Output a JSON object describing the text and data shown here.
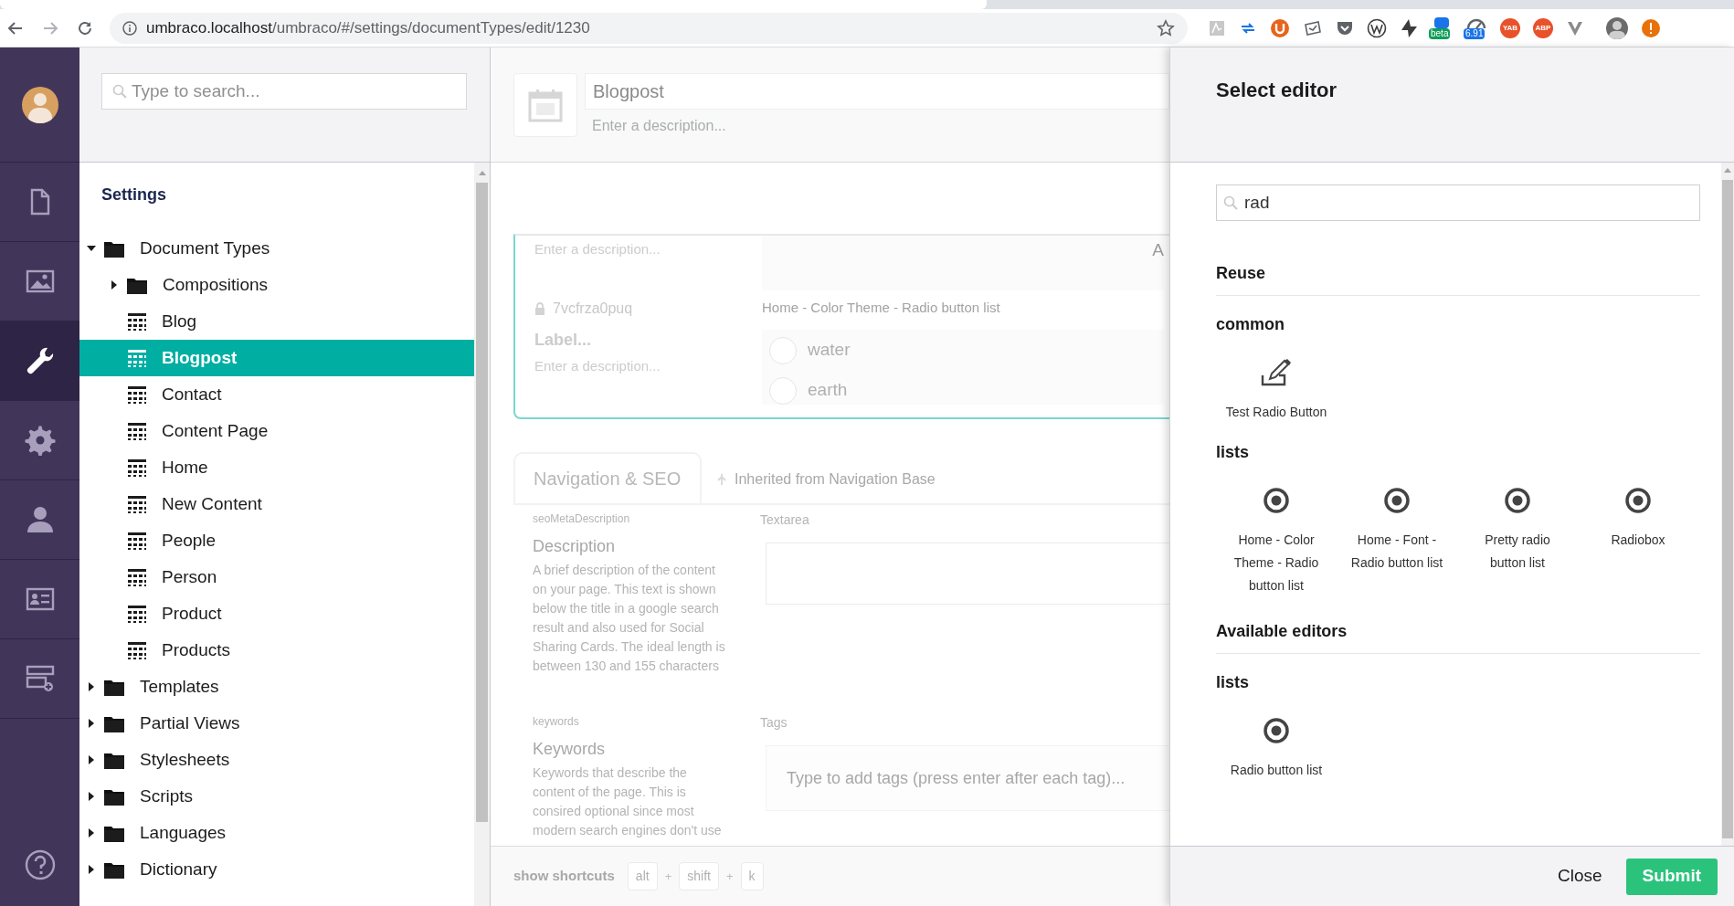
{
  "browser": {
    "url_host": "umbraco.localhost",
    "url_path": "/umbraco/#/settings/documentTypes/edit/1230",
    "extensions": [
      {
        "kind": "pdf"
      },
      {
        "kind": "arrows"
      },
      {
        "kind": "shield"
      },
      {
        "kind": "scan"
      },
      {
        "kind": "pocket"
      },
      {
        "kind": "wp"
      },
      {
        "kind": "bolt"
      },
      {
        "kind": "tag",
        "badge": "beta"
      },
      {
        "kind": "gauge",
        "badge": "6.91"
      },
      {
        "kind": "round",
        "text": "YAB"
      },
      {
        "kind": "round",
        "text": "ABP"
      },
      {
        "kind": "vee"
      },
      {
        "kind": "avatar"
      },
      {
        "kind": "alert"
      }
    ]
  },
  "sections": [
    {
      "selected": false
    },
    {
      "selected": false
    },
    {
      "selected": true
    },
    {
      "selected": false
    },
    {
      "selected": false
    },
    {
      "selected": false
    },
    {
      "selected": false
    }
  ],
  "tree": {
    "search_placeholder": "Type to search...",
    "title": "Settings",
    "nodes": [
      {
        "label": "Document Types",
        "kind": "folder",
        "expanded": true,
        "selected": false,
        "children": [
          {
            "label": "Compositions",
            "kind": "folder",
            "expanded": false,
            "selected": false
          },
          {
            "label": "Blog",
            "kind": "doctype",
            "selected": false
          },
          {
            "label": "Blogpost",
            "kind": "doctype",
            "selected": true
          },
          {
            "label": "Contact",
            "kind": "doctype",
            "selected": false
          },
          {
            "label": "Content Page",
            "kind": "doctype",
            "selected": false
          },
          {
            "label": "Home",
            "kind": "doctype",
            "selected": false
          },
          {
            "label": "New Content",
            "kind": "doctype",
            "selected": false
          },
          {
            "label": "People",
            "kind": "doctype",
            "selected": false
          },
          {
            "label": "Person",
            "kind": "doctype",
            "selected": false
          },
          {
            "label": "Product",
            "kind": "doctype",
            "selected": false
          },
          {
            "label": "Products",
            "kind": "doctype",
            "selected": false
          }
        ]
      },
      {
        "label": "Templates",
        "kind": "folder",
        "expanded": false,
        "selected": false
      },
      {
        "label": "Partial Views",
        "kind": "folder",
        "expanded": false,
        "selected": false
      },
      {
        "label": "Stylesheets",
        "kind": "folder",
        "expanded": false,
        "selected": false
      },
      {
        "label": "Scripts",
        "kind": "folder",
        "expanded": false,
        "selected": false
      },
      {
        "label": "Languages",
        "kind": "folder",
        "expanded": false,
        "selected": false
      },
      {
        "label": "Dictionary",
        "kind": "folder",
        "expanded": false,
        "selected": false
      }
    ]
  },
  "editor": {
    "name": "Blogpost",
    "description_placeholder": "Enter a description...",
    "property_card": {
      "description_placeholder": "Enter a description...",
      "corner_text": "A",
      "alias": "7vcfrza0puq",
      "label_placeholder": "Label...",
      "label_description_placeholder": "Enter a description...",
      "editor_name": "Home - Color Theme - Radio button list",
      "options": [
        {
          "label": "water",
          "checked": false
        },
        {
          "label": "earth",
          "checked": false
        }
      ]
    },
    "group": {
      "name": "Navigation & SEO",
      "inherited_prefix": "Inherited from",
      "inherited_from": "Navigation Base"
    },
    "properties": [
      {
        "kind": "textarea",
        "alias": "seoMetaDescription",
        "name": "Description",
        "description": "A brief description of the content on your page. This text is shown below the title in a google search result and also used for Social Sharing Cards. The ideal length is between 130 and 155 characters",
        "editor": "Textarea"
      },
      {
        "kind": "tags",
        "alias": "keywords",
        "name": "Keywords",
        "description": "Keywords that describe the content of the page. This is consired optional since most modern search engines don't use",
        "editor": "Tags",
        "placeholder": "Type to add tags (press enter after each tag)..."
      }
    ],
    "shortcuts": {
      "label": "show shortcuts",
      "keys": [
        "alt",
        "shift",
        "k"
      ],
      "joiner": "+"
    }
  },
  "select_editor": {
    "title": "Select editor",
    "search_value": "rad",
    "sections": [
      {
        "title": "Reuse",
        "groups": [
          {
            "name": "common",
            "items": [
              {
                "label": "Test Radio Button",
                "kind": "custom"
              }
            ]
          },
          {
            "name": "lists",
            "items": [
              {
                "label": "Home - Color Theme - Radio button list",
                "kind": "list"
              },
              {
                "label": "Home - Font - Radio button list",
                "kind": "list"
              },
              {
                "label": "Pretty radio button list",
                "kind": "list"
              },
              {
                "label": "Radiobox",
                "kind": "list"
              }
            ]
          }
        ]
      },
      {
        "title": "Available editors",
        "groups": [
          {
            "name": "lists",
            "items": [
              {
                "label": "Radio button list",
                "kind": "list"
              }
            ]
          }
        ]
      }
    ],
    "buttons": [
      {
        "label": "Close",
        "kind": "link"
      },
      {
        "label": "Submit",
        "kind": "primary"
      }
    ]
  }
}
